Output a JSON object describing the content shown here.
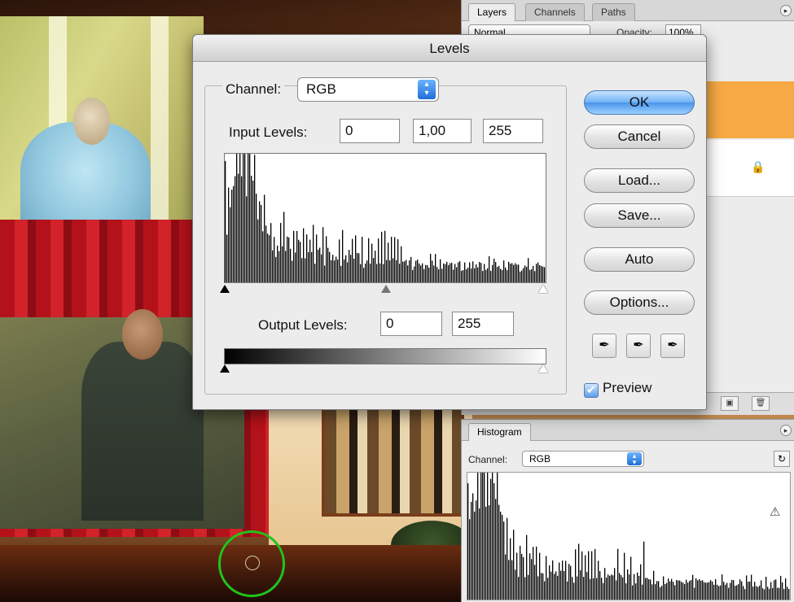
{
  "layers_panel": {
    "tabs": [
      "Layers",
      "Channels",
      "Paths"
    ],
    "blend_mode": "Normal",
    "opacity_label": "Opacity:",
    "opacity_value": "100%"
  },
  "levels_dialog": {
    "title": "Levels",
    "channel_label": "Channel:",
    "channel_value": "RGB",
    "input_levels_label": "Input Levels:",
    "input_levels": [
      "0",
      "1,00",
      "255"
    ],
    "output_levels_label": "Output Levels:",
    "output_levels": [
      "0",
      "255"
    ],
    "buttons": {
      "ok": "OK",
      "cancel": "Cancel",
      "load": "Load...",
      "save": "Save...",
      "auto": "Auto",
      "options": "Options..."
    },
    "preview_label": "Preview",
    "preview_checked": true
  },
  "histogram_panel": {
    "tab": "Histogram",
    "channel_label": "Channel:",
    "channel_value": "RGB"
  },
  "colors": {
    "accent_blue": "#4a94ea",
    "layer_highlight": "#f6a945",
    "green_marker": "#21c41a"
  }
}
